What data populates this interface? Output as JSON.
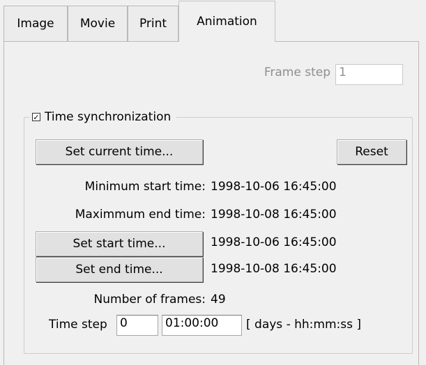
{
  "tabs": [
    {
      "label": "Image",
      "active": false
    },
    {
      "label": "Movie",
      "active": false
    },
    {
      "label": "Print",
      "active": false
    },
    {
      "label": "Animation",
      "active": true
    }
  ],
  "frame_step": {
    "label": "Frame step",
    "value": "1",
    "enabled": false
  },
  "time_sync": {
    "checkbox_label": "Time synchronization",
    "checked": true,
    "set_current_time_label": "Set current time...",
    "reset_label": "Reset",
    "min_start_label": "Minimum start time:",
    "min_start_value": "1998-10-06 16:45:00",
    "max_end_label": "Maximmum end time:",
    "max_end_value": "1998-10-08 16:45:00",
    "set_start_label": "Set start time...",
    "start_value": "1998-10-06 16:45:00",
    "set_end_label": "Set end time...",
    "end_value": "1998-10-08 16:45:00",
    "num_frames_label": "Number of frames:",
    "num_frames_value": "49",
    "time_step_label": "Time step",
    "time_step_days": "0",
    "time_step_hms": "01:00:00",
    "time_step_units": "[ days - hh:mm:ss ]"
  }
}
